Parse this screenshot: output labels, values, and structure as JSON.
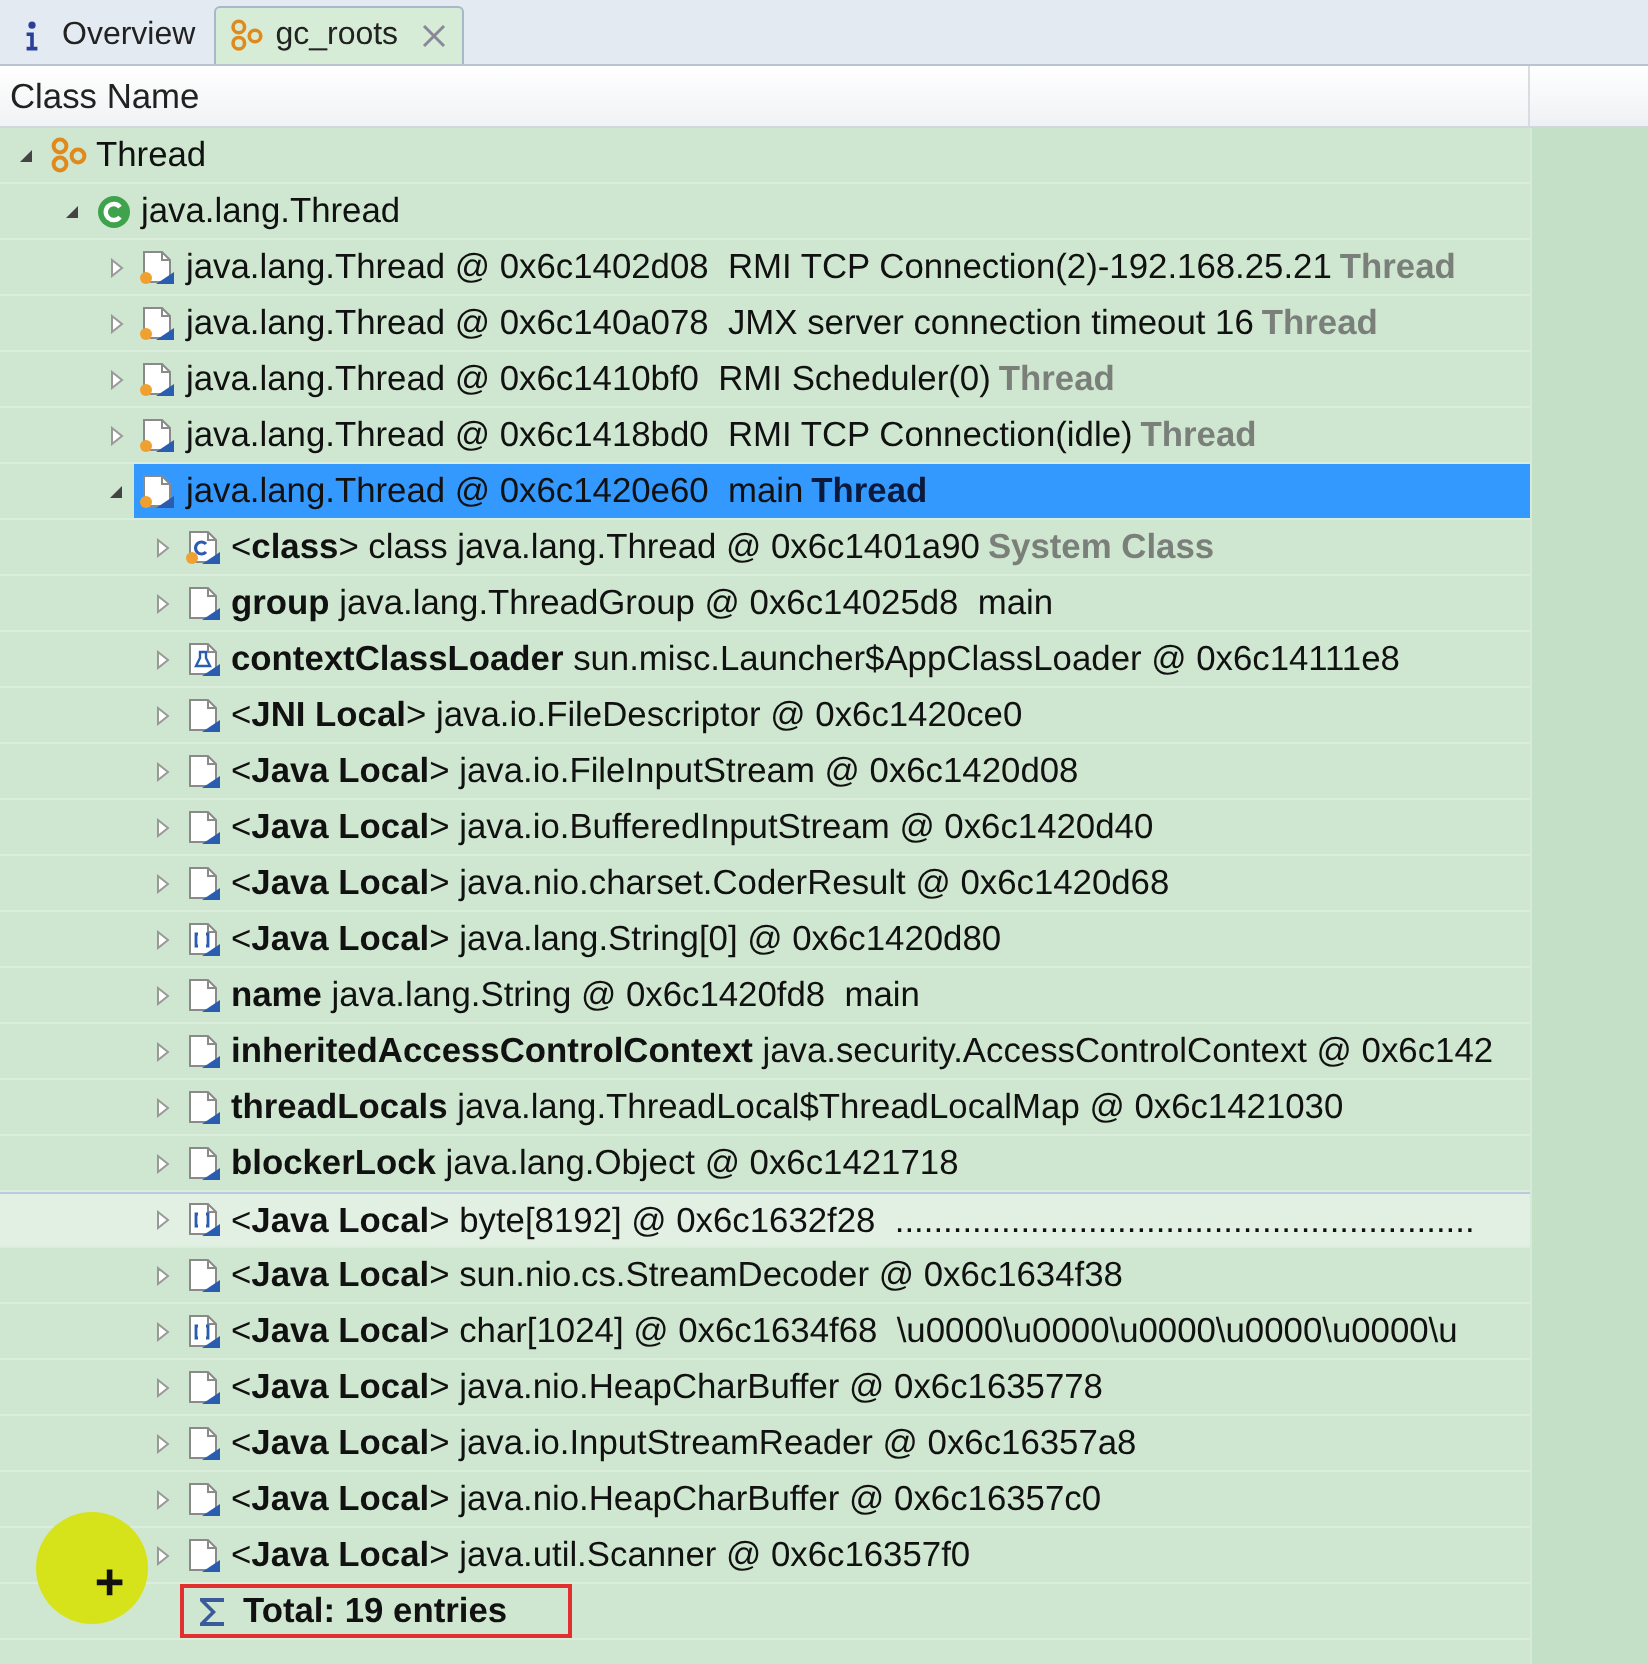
{
  "tabs": [
    {
      "label": "Overview",
      "kind": "info",
      "selected": false,
      "closable": false
    },
    {
      "label": "gc_roots",
      "kind": "group",
      "selected": true,
      "closable": true
    }
  ],
  "table": {
    "columns": [
      "Class Name"
    ],
    "rows": [
      {
        "kind": "group",
        "text": "Thread",
        "expanded": true,
        "selected": false,
        "hovered": false,
        "children": [
          {
            "kind": "class",
            "text": "java.lang.Thread",
            "expanded": true,
            "selected": false,
            "hovered": false,
            "children": [
              {
                "kind": "thread",
                "text": "java.lang.Thread @ 0x6c1402d08  RMI TCP Connection(2)-192.168.25.21",
                "tag": "Thread",
                "expanded": false,
                "selected": false,
                "hovered": false
              },
              {
                "kind": "thread",
                "text": "java.lang.Thread @ 0x6c140a078  JMX server connection timeout 16",
                "tag": "Thread",
                "expanded": false,
                "selected": false,
                "hovered": false
              },
              {
                "kind": "thread",
                "text": "java.lang.Thread @ 0x6c1410bf0  RMI Scheduler(0)",
                "tag": "Thread",
                "expanded": false,
                "selected": false,
                "hovered": false
              },
              {
                "kind": "thread",
                "text": "java.lang.Thread @ 0x6c1418bd0  RMI TCP Connection(idle)",
                "tag": "Thread",
                "expanded": false,
                "selected": false,
                "hovered": false
              },
              {
                "kind": "thread",
                "text": "java.lang.Thread @ 0x6c1420e60  main",
                "tag": "Thread",
                "expanded": true,
                "selected": true,
                "hovered": false,
                "children": [
                  {
                    "kind": "class-object",
                    "text": "<**class**> class java.lang.Thread @ 0x6c1401a90",
                    "tag": "System Class",
                    "expanded": false,
                    "selected": false,
                    "hovered": false
                  },
                  {
                    "kind": "object",
                    "text": "**group** java.lang.ThreadGroup @ 0x6c14025d8  main",
                    "expanded": false,
                    "selected": false,
                    "hovered": false
                  },
                  {
                    "kind": "loader",
                    "text": "**contextClassLoader** sun.misc.Launcher$AppClassLoader @ 0x6c14111e8",
                    "expanded": false,
                    "selected": false,
                    "hovered": false
                  },
                  {
                    "kind": "object",
                    "text": "<**JNI Local**> java.io.FileDescriptor @ 0x6c1420ce0",
                    "expanded": false,
                    "selected": false,
                    "hovered": false
                  },
                  {
                    "kind": "object",
                    "text": "<**Java Local**> java.io.FileInputStream @ 0x6c1420d08",
                    "expanded": false,
                    "selected": false,
                    "hovered": false
                  },
                  {
                    "kind": "object",
                    "text": "<**Java Local**> java.io.BufferedInputStream @ 0x6c1420d40",
                    "expanded": false,
                    "selected": false,
                    "hovered": false
                  },
                  {
                    "kind": "object",
                    "text": "<**Java Local**> java.nio.charset.CoderResult @ 0x6c1420d68",
                    "expanded": false,
                    "selected": false,
                    "hovered": false
                  },
                  {
                    "kind": "array",
                    "text": "<**Java Local**> java.lang.String[0] @ 0x6c1420d80",
                    "expanded": false,
                    "selected": false,
                    "hovered": false
                  },
                  {
                    "kind": "object",
                    "text": "**name** java.lang.String @ 0x6c1420fd8  main",
                    "expanded": false,
                    "selected": false,
                    "hovered": false
                  },
                  {
                    "kind": "object",
                    "text": "**inheritedAccessControlContext** java.security.AccessControlContext @ 0x6c142",
                    "expanded": false,
                    "selected": false,
                    "hovered": false
                  },
                  {
                    "kind": "object",
                    "text": "**threadLocals** java.lang.ThreadLocal$ThreadLocalMap @ 0x6c1421030",
                    "expanded": false,
                    "selected": false,
                    "hovered": false
                  },
                  {
                    "kind": "object",
                    "text": "**blockerLock** java.lang.Object @ 0x6c1421718",
                    "expanded": false,
                    "selected": false,
                    "hovered": false
                  },
                  {
                    "kind": "array",
                    "text": "<**Java Local**> byte[8192] @ 0x6c1632f28  ............................................................",
                    "expanded": false,
                    "selected": false,
                    "hovered": true
                  },
                  {
                    "kind": "object",
                    "text": "<**Java Local**> sun.nio.cs.StreamDecoder @ 0x6c1634f38",
                    "expanded": false,
                    "selected": false,
                    "hovered": false
                  },
                  {
                    "kind": "array",
                    "text": "<**Java Local**> char[1024] @ 0x6c1634f68  \\u0000\\u0000\\u0000\\u0000\\u0000\\u",
                    "expanded": false,
                    "selected": false,
                    "hovered": false
                  },
                  {
                    "kind": "object",
                    "text": "<**Java Local**> java.nio.HeapCharBuffer @ 0x6c1635778",
                    "expanded": false,
                    "selected": false,
                    "hovered": false
                  },
                  {
                    "kind": "object",
                    "text": "<**Java Local**> java.io.InputStreamReader @ 0x6c16357a8",
                    "expanded": false,
                    "selected": false,
                    "hovered": false
                  },
                  {
                    "kind": "object",
                    "text": "<**Java Local**> java.nio.HeapCharBuffer @ 0x6c16357c0",
                    "expanded": false,
                    "selected": false,
                    "hovered": false
                  },
                  {
                    "kind": "object",
                    "text": "<**Java Local**> java.util.Scanner @ 0x6c16357f0",
                    "expanded": false,
                    "selected": false,
                    "hovered": false
                  },
                  {
                    "kind": "total",
                    "text": "Total: 19 entries",
                    "outlined": true
                  }
                ]
              }
            ]
          }
        ]
      }
    ]
  }
}
